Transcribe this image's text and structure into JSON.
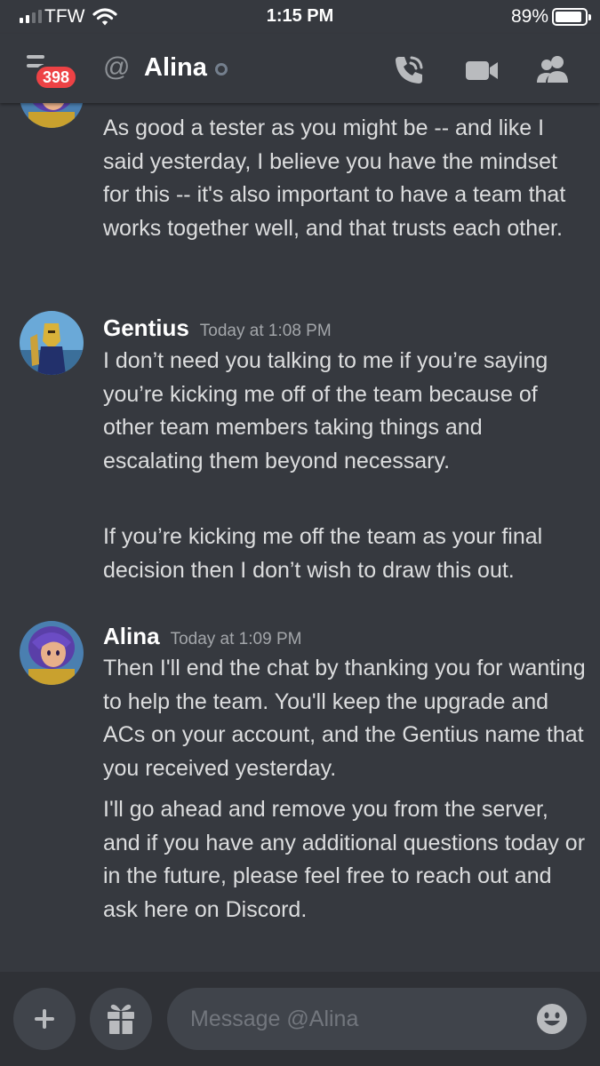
{
  "status_bar": {
    "carrier": "TFW",
    "time": "1:15 PM",
    "battery": "89%"
  },
  "header": {
    "badge": "398",
    "at_symbol": "@",
    "channel_name": "Alina",
    "icons": [
      "menu-icon",
      "at-icon",
      "call-icon",
      "video-icon",
      "members-icon"
    ]
  },
  "messages": [
    {
      "author": "",
      "timestamp": "",
      "avatar_icon": "alina-avatar",
      "lines": [
        "As good a tester as you might be -- and like I said yesterday, I believe you have the mindset for this -- it's also important to have a team that works together well, and that trusts each other."
      ]
    },
    {
      "author": "Gentius",
      "timestamp": "Today at 1:08 PM",
      "avatar_icon": "gentius-avatar",
      "lines": [
        "I don’t need you talking to me if you’re saying you’re kicking me off of the team because of other team members taking things and escalating them beyond necessary.",
        "If you’re kicking me off the team as your final decision then I don’t wish to draw this out."
      ]
    },
    {
      "author": "Alina",
      "timestamp": "Today at 1:09 PM",
      "avatar_icon": "alina-avatar",
      "lines": [
        "Then I'll end the chat by thanking you for wanting to help the team. You'll keep the upgrade and ACs on your account, and the Gentius name that you received yesterday.",
        "I'll go ahead and remove you from the server, and if you have any additional questions today or in the future, please feel free to reach out and ask here on Discord."
      ]
    }
  ],
  "composer": {
    "placeholder": "Message @Alina",
    "icons": [
      "plus-icon",
      "gift-icon",
      "emoji-icon"
    ]
  },
  "colors": {
    "background": "#36393f",
    "composer_bg": "#2f3136",
    "input_bg": "#40444b",
    "badge": "#ed4245",
    "text": "#dcddde",
    "muted": "#a3a6aa"
  }
}
